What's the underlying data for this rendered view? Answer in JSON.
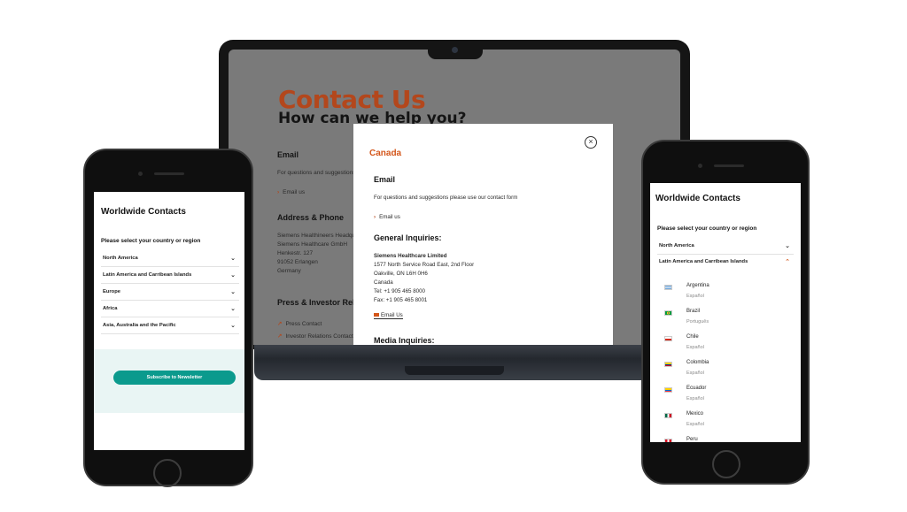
{
  "laptop": {
    "background": {
      "title": "Contact Us",
      "subtitle": "How can we help you?",
      "email_heading": "Email",
      "email_text": "For questions and suggestions",
      "email_link": "Email us",
      "address_heading": "Address & Phone",
      "address_lines": [
        "Siemens Healthineers Headqu",
        "Siemens Healthcare GmbH",
        "Henkestr. 127",
        "91052 Erlangen",
        "Germany"
      ],
      "press_heading": "Press & Investor Relat",
      "press_links": [
        "Press Contact",
        "Investor Relations Contact"
      ]
    },
    "modal": {
      "country": "Canada",
      "close_icon": "×",
      "email_heading": "Email",
      "email_text": "For questions and suggestions please use our contact form",
      "email_link": "Email us",
      "general_heading": "General Inquiries:",
      "general_lines": [
        "Siemens Healthcare Limited",
        "1577 North Service Road East, 2nd Floor",
        "Oakville, ON L6H 0H6",
        "Canada",
        "Tel: +1 905 465 8000",
        "Fax: +1 905 465 8001"
      ],
      "general_email": "Email Us",
      "media_heading": "Media Inquiries:"
    }
  },
  "phone_left": {
    "title": "Worldwide Contacts",
    "prompt": "Please select your country or region",
    "regions": [
      "North America",
      "Latin America and Carribean Islands",
      "Europe",
      "Africa",
      "Asia, Australia and the Pacific"
    ],
    "newsletter_button": "Subscribe to Newsletter"
  },
  "phone_right": {
    "title": "Worldwide Contacts",
    "prompt": "Please select your country or region",
    "regions": [
      "North America",
      "Latin America and Carribean Islands"
    ],
    "countries": [
      {
        "name": "Argentina",
        "lang": "Español"
      },
      {
        "name": "Brazil",
        "lang": "Português"
      },
      {
        "name": "Chile",
        "lang": "Español"
      },
      {
        "name": "Colombia",
        "lang": "Español"
      },
      {
        "name": "Ecuador",
        "lang": "Español"
      },
      {
        "name": "Mexico",
        "lang": "Español"
      },
      {
        "name": "Peru",
        "lang": ""
      }
    ]
  },
  "colors": {
    "accent_orange": "#d4561a",
    "title_orange": "#b3471c",
    "newsletter_teal": "#0b9a8d"
  },
  "icons": {
    "chevron_down": "⌄",
    "chevron_up": "⌃",
    "chevron_right": "›"
  }
}
